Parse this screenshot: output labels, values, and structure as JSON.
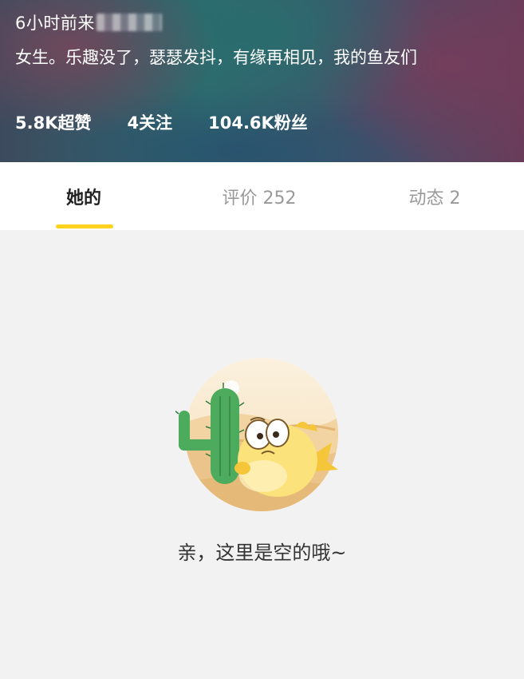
{
  "profile": {
    "time_ago": "6小时前来",
    "bio": "女生。乐趣没了，瑟瑟发抖，有缘再相见，我的鱼友们",
    "stats": {
      "likes": "5.8K超赞",
      "following": "4关注",
      "fans": "104.6K粉丝"
    }
  },
  "tabs": [
    {
      "label": "她的",
      "active": true
    },
    {
      "label": "评价 252",
      "active": false
    },
    {
      "label": "动态 2",
      "active": false
    }
  ],
  "colors": {
    "accent": "#ffd21f",
    "page_bg": "#f2f2f2"
  },
  "empty_state": {
    "illustration": "cactus-fish-desert-illustration",
    "message": "亲，这里是空的哦~"
  }
}
